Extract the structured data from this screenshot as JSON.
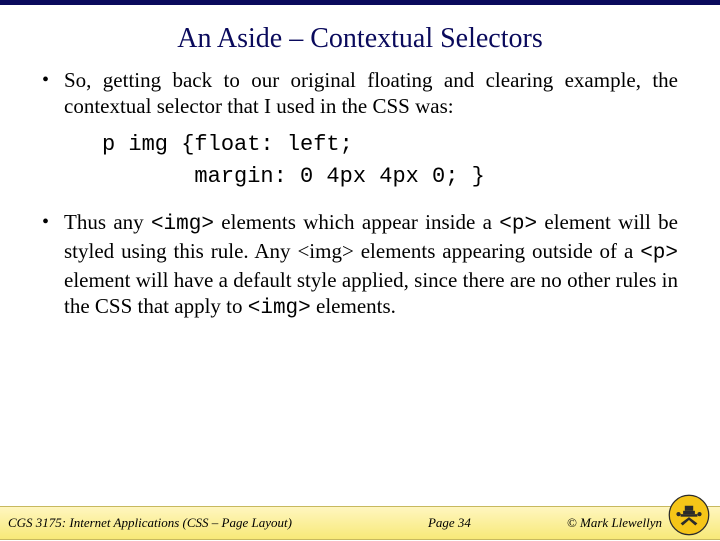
{
  "title": "An Aside – Contextual Selectors",
  "bullet1": "So, getting back to our original floating and clearing example, the contextual selector that I used in the CSS was:",
  "code_line1": "p img {float: left;",
  "code_line2": "       margin: 0 4px 4px 0; }",
  "bullet2_a": "Thus any ",
  "bullet2_b": "<img>",
  "bullet2_c": "  elements which appear inside a ",
  "bullet2_d": "<p>",
  "bullet2_e": " element will be styled using this rule.  Any <img> elements appearing outside of a ",
  "bullet2_f": "<p>",
  "bullet2_g": " element will have a default style applied, since there are no other rules in the CSS that apply to ",
  "bullet2_h": "<img>",
  "bullet2_i": "  elements.",
  "footer": {
    "left": "CGS 3175: Internet Applications (CSS – Page Layout)",
    "center": "Page 34",
    "right": "© Mark Llewellyn"
  }
}
